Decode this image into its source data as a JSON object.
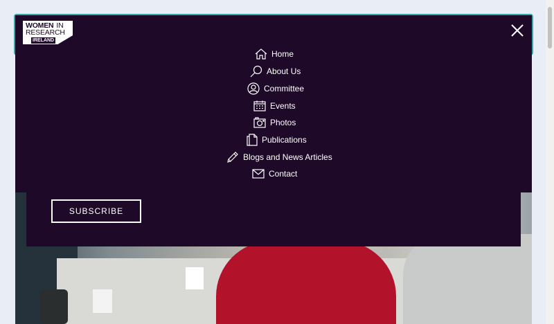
{
  "brand": {
    "logo_line1_bold": "WOMEN",
    "logo_line1_rest": "IN",
    "logo_line2": "RESEARCH",
    "logo_line3": "IRELAND"
  },
  "menu": {
    "items": [
      {
        "label": "Home",
        "icon": "home-icon"
      },
      {
        "label": "About Us",
        "icon": "magnifier-icon"
      },
      {
        "label": "Committee",
        "icon": "user-circle-icon"
      },
      {
        "label": "Events",
        "icon": "calendar-icon"
      },
      {
        "label": "Photos",
        "icon": "camera-icon"
      },
      {
        "label": "Publications",
        "icon": "document-icon"
      },
      {
        "label": "Blogs and News Articles",
        "icon": "pencil-icon"
      },
      {
        "label": "Contact",
        "icon": "envelope-icon"
      }
    ]
  },
  "subscribe": {
    "label": "SUBSCRIBE"
  },
  "colors": {
    "panel_bg": "#1e0a28",
    "header_outline": "#36a7a4",
    "page_bg": "#e9eef6",
    "text": "#ffffff"
  }
}
